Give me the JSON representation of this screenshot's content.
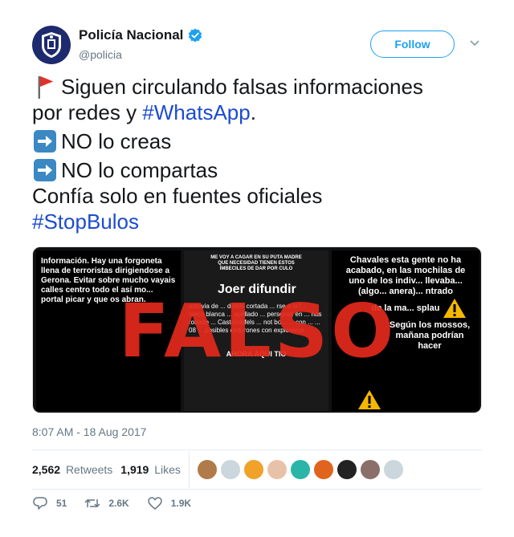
{
  "account": {
    "name": "Policía Nacional",
    "handle": "@policia",
    "verified": true
  },
  "follow_label": "Follow",
  "tweet": {
    "line1": "Siguen circulando falsas informaciones",
    "line2_pre": "por redes y ",
    "line2_hashtag": "#WhatsApp",
    "line2_post": ".",
    "line3": "NO lo creas",
    "line4": "NO lo compartas",
    "line5": "Confía solo en fuentes oficiales",
    "line6_hashtag": "#StopBulos"
  },
  "media": {
    "overlay_text": "FALSO",
    "panel1_text": "Información. Hay una forgoneta llena de terroristas dirigiendose a Gerona. Evitar sobre mucho vayais calles centro todo el así mo... portal picar y que os abran.",
    "panel2_header": "ME VOY A CAGAR EN SU PUTA MADRE QUE NECESIDAD TIENEN ESTOS IMBECILES DE DAR POR CULO",
    "panel2_title": "Joer difundir",
    "panel2_body": "autovia de ... defels cortada ... rse a la f... Iveco blanca ... apellado ... personas en ... has robado ... Castelldefels ... not bo... ... con ... ... 08 ... posibles cinturones con explosivos.",
    "panel2_footer": "AHORA AQUI TIO",
    "panel3_top": "Chavales esta gente no ha acabado, en las mochilas de uno de los indiv... llevaba... (algo... anera)... ntrado",
    "panel3_mid": "de la ma... splau",
    "panel3_bottom": "Según los mossos, mañana podrían hacer"
  },
  "timestamp": "8:07 AM - 18 Aug 2017",
  "stats": {
    "retweets_count": "2,562",
    "retweets_label": "Retweets",
    "likes_count": "1,919",
    "likes_label": "Likes"
  },
  "actions": {
    "replies": "51",
    "retweets": "2.6K",
    "likes": "1.9K"
  },
  "colors": {
    "accent": "#1da1f2",
    "hashtag": "#1b4bd1",
    "falso_red": "#e32a1c",
    "avatar_bg": "#1e2a6e"
  },
  "icons": [
    "police-badge-icon",
    "verified-icon",
    "chevron-down-icon",
    "red-flag-icon",
    "right-arrow-icon",
    "warning-icon",
    "reply-icon",
    "retweet-icon",
    "like-icon"
  ]
}
